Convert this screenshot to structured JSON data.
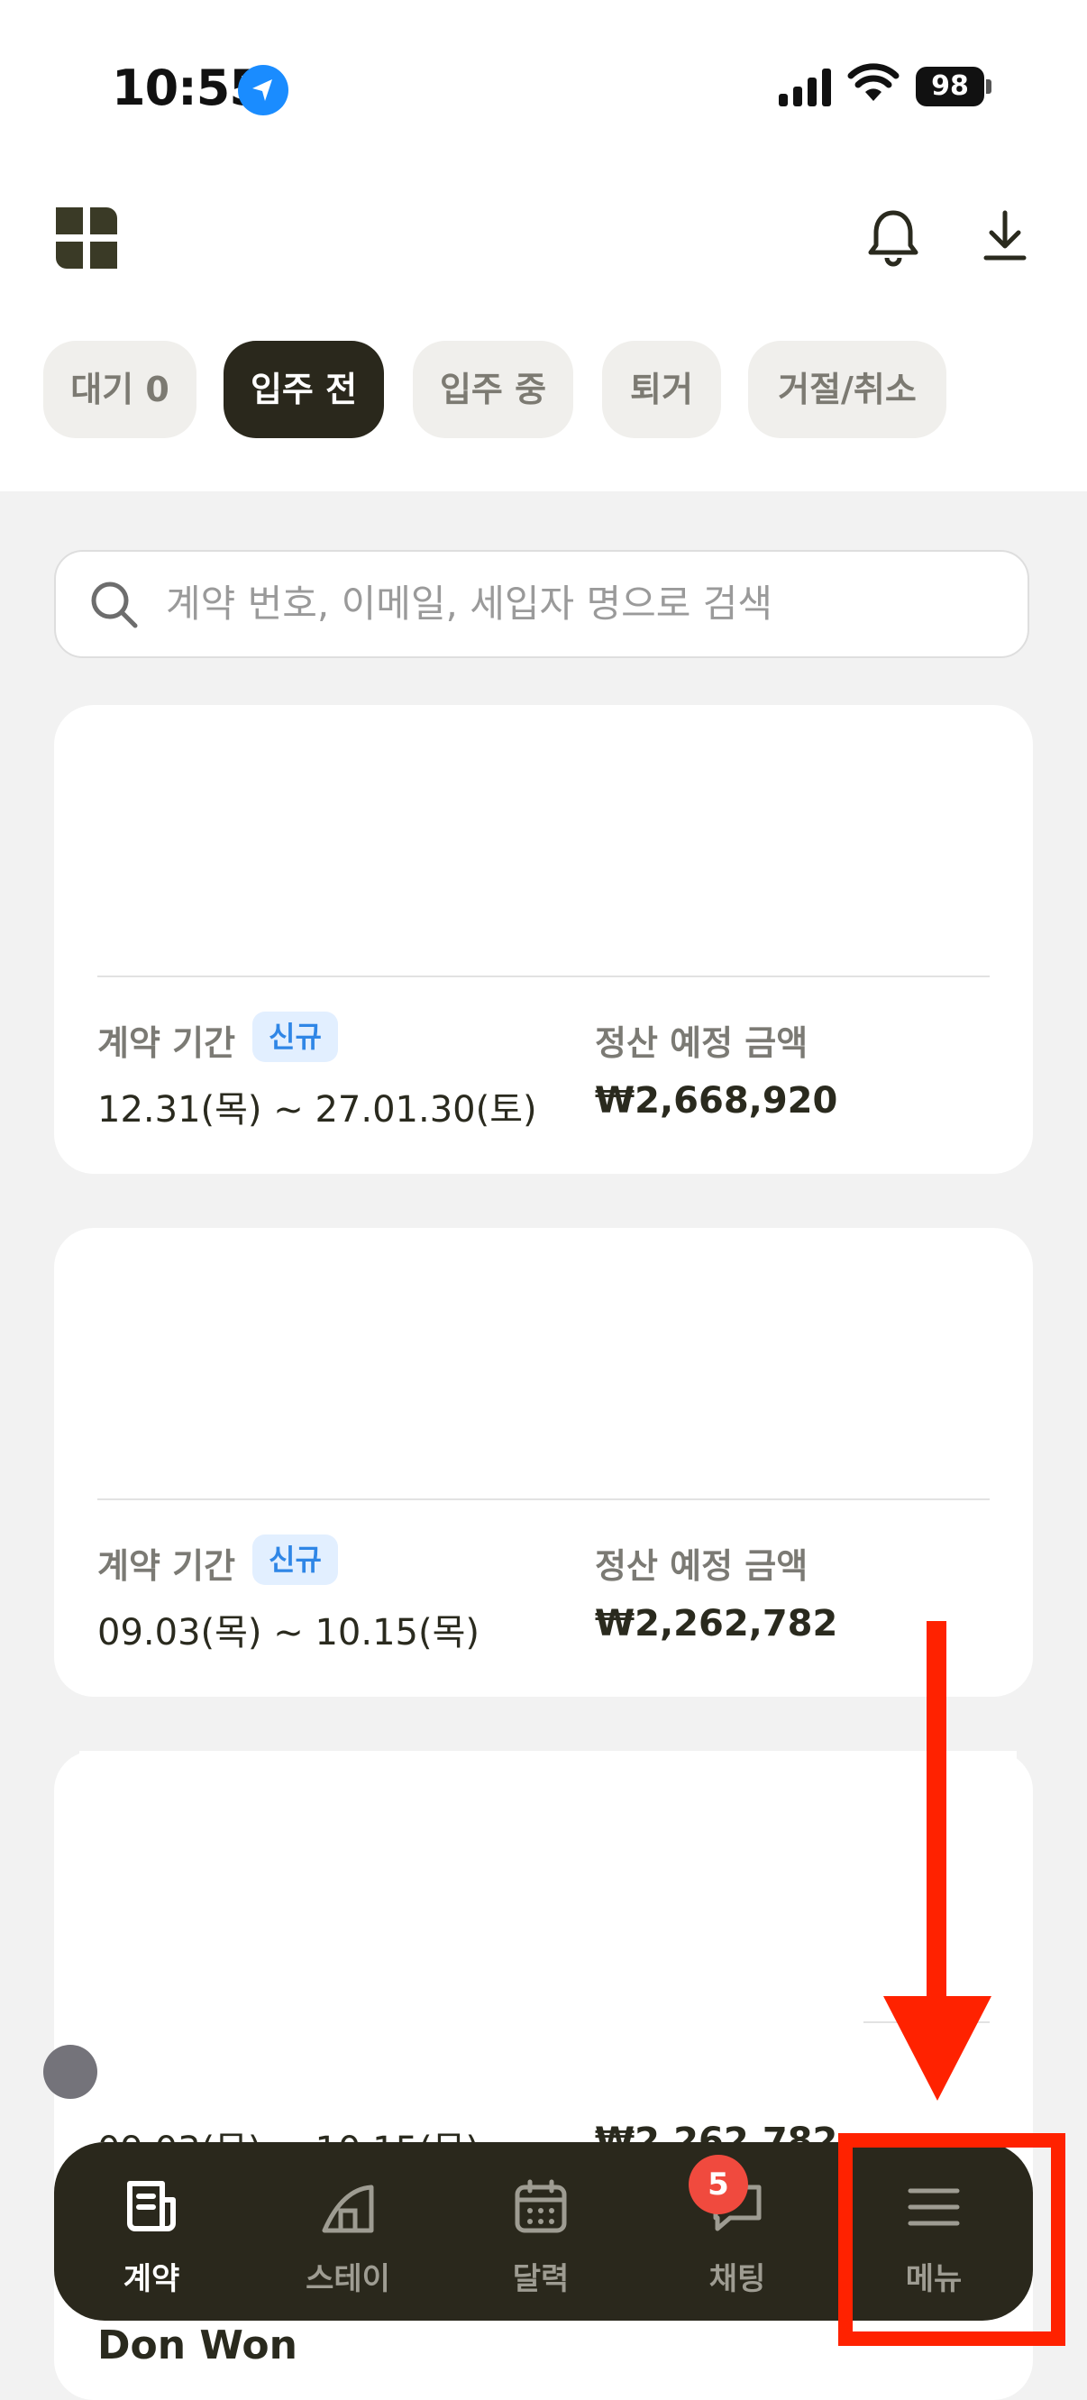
{
  "status_bar": {
    "time": "10:55",
    "battery": "98"
  },
  "tabs": [
    {
      "label": "대기 0",
      "active": false
    },
    {
      "label": "입주 전",
      "active": true
    },
    {
      "label": "입주 중",
      "active": false
    },
    {
      "label": "퇴거",
      "active": false
    },
    {
      "label": "거절/취소",
      "active": false
    }
  ],
  "search": {
    "placeholder": "계약 번호, 이메일, 세입자 명으로 검색"
  },
  "contracts": [
    {
      "period_label": "계약 기간",
      "badge": "신규",
      "period": "12.31(목) ~ 27.01.30(토)",
      "amount_label": "정산 예정 금액",
      "amount": "₩2,668,920"
    },
    {
      "period_label": "계약 기간",
      "badge": "신규",
      "period": "09.03(목) ~ 10.15(목)",
      "amount_label": "정산 예정 금액",
      "amount": "₩2,262,782"
    }
  ],
  "card3_partial": {
    "period": "09.03(목) ~ 10.15(목)",
    "amount": "₩2,262,782"
  },
  "next_tenant": "Don Won",
  "bottom_nav": [
    {
      "label": "계약",
      "icon": "contract-icon",
      "active": true
    },
    {
      "label": "스테이",
      "icon": "stay-icon",
      "active": false
    },
    {
      "label": "달력",
      "icon": "calendar-icon",
      "active": false
    },
    {
      "label": "채팅",
      "icon": "chat-icon",
      "active": false,
      "badge": "5"
    },
    {
      "label": "메뉴",
      "icon": "menu-icon",
      "active": false
    }
  ],
  "colors": {
    "accent_dark": "#2a281c",
    "badge_red": "#f04a3e",
    "annotation_red": "#ff2200",
    "new_badge": "#2f86e6"
  }
}
